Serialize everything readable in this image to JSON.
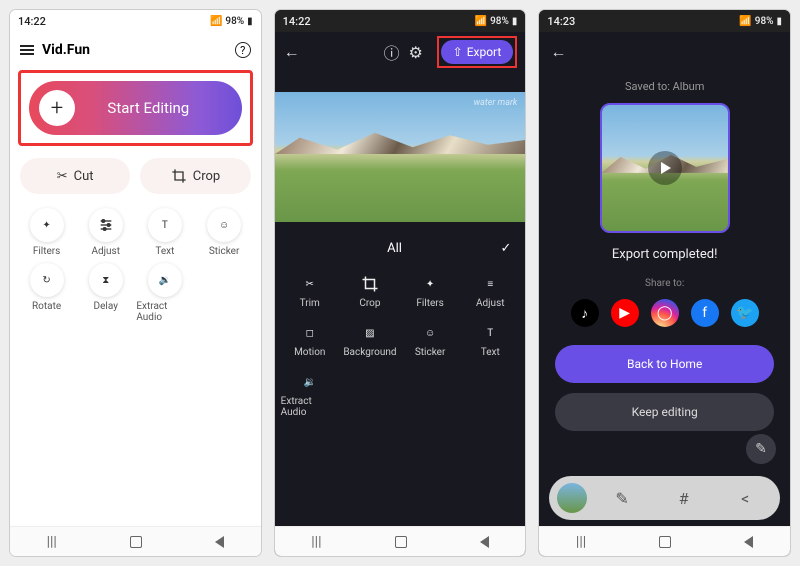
{
  "screen1": {
    "status": {
      "time": "14:22",
      "battery": "98%"
    },
    "app_title": "Vid.Fun",
    "start_label": "Start Editing",
    "quick": {
      "cut": "Cut",
      "crop": "Crop"
    },
    "tools": {
      "filters": "Filters",
      "adjust": "Adjust",
      "text": "Text",
      "sticker": "Sticker",
      "rotate": "Rotate",
      "delay": "Delay",
      "extract_audio": "Extract Audio"
    }
  },
  "screen2": {
    "status": {
      "time": "14:22",
      "battery": "98%"
    },
    "export_label": "Export",
    "watermark": "water mark",
    "category_all": "All",
    "tools": {
      "trim": "Trim",
      "crop": "Crop",
      "filters": "Filters",
      "adjust": "Adjust",
      "motion": "Motion",
      "background": "Background",
      "sticker": "Sticker",
      "text": "Text",
      "extract_audio": "Extract Audio"
    }
  },
  "screen3": {
    "status": {
      "time": "14:23",
      "battery": "98%"
    },
    "saved_to": "Saved to: Album",
    "completed": "Export completed!",
    "share_to": "Share to:",
    "back_home": "Back to Home",
    "keep_editing": "Keep editing",
    "share": {
      "tiktok": "TikTok",
      "youtube": "YouTube",
      "instagram": "Instagram",
      "facebook": "Facebook",
      "twitter": "Twitter"
    }
  }
}
